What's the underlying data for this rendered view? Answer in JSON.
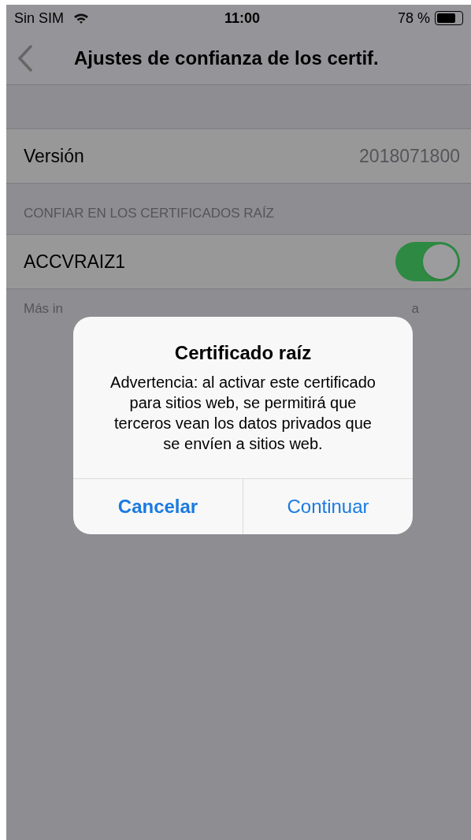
{
  "status_bar": {
    "carrier": "Sin SIM",
    "time": "11:00",
    "battery": "78 %"
  },
  "nav_bar": {
    "title": "Ajustes de confianza de los certif."
  },
  "version_row": {
    "label": "Versión",
    "value": "2018071800"
  },
  "section": {
    "header": "CONFIAR EN LOS CERTIFICADOS RAÍZ",
    "items": [
      {
        "label": "ACCVRAIZ1",
        "on": true
      }
    ],
    "footer_left": "Más in",
    "footer_right": "a"
  },
  "alert": {
    "title": "Certificado raíz",
    "message": "Advertencia: al activar este certificado para sitios web, se permitirá que terceros vean los datos privados que se envíen a sitios web.",
    "buttons": [
      {
        "label": "Cancelar",
        "kind": "cancel"
      },
      {
        "label": "Continuar",
        "kind": "default"
      }
    ]
  }
}
